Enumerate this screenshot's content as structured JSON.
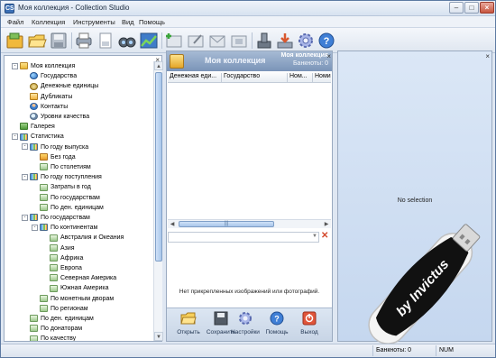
{
  "window": {
    "title": "Моя коллекция - Collection Studio",
    "app_icon": "CS"
  },
  "menu": {
    "items": [
      "Файл",
      "Коллекция",
      "Инструменты",
      "Вид",
      "Помощь"
    ]
  },
  "toolbar": {
    "icons": [
      "open-collection-icon",
      "open-folder-icon",
      "save-icon",
      "print-icon",
      "page-icon",
      "binoculars-icon",
      "chart-icon",
      "add-item-icon",
      "edit-item-icon",
      "mail-icon",
      "item-icon",
      "stamp-icon",
      "download-icon",
      "settings-icon",
      "help-icon"
    ]
  },
  "tree": {
    "nodes": [
      {
        "label": "Моя коллекция",
        "depth": 0,
        "toggle": "-",
        "icon": "folder"
      },
      {
        "label": "Государства",
        "depth": 1,
        "toggle": "",
        "icon": "globe"
      },
      {
        "label": "Денежные единицы",
        "depth": 1,
        "toggle": "",
        "icon": "coin"
      },
      {
        "label": "Дубликаты",
        "depth": 1,
        "toggle": "",
        "icon": "dup"
      },
      {
        "label": "Контакты",
        "depth": 1,
        "toggle": "",
        "icon": "person"
      },
      {
        "label": "Уровни качества",
        "depth": 1,
        "toggle": "",
        "icon": "mag"
      },
      {
        "label": "Галерея",
        "depth": 0,
        "toggle": "",
        "icon": "gallery"
      },
      {
        "label": "Статистика",
        "depth": 0,
        "toggle": "-",
        "icon": "chart"
      },
      {
        "label": "По году выпуска",
        "depth": 1,
        "toggle": "-",
        "icon": "chart"
      },
      {
        "label": "Без года",
        "depth": 2,
        "toggle": "",
        "icon": "flag"
      },
      {
        "label": "По столетиям",
        "depth": 2,
        "toggle": "",
        "icon": "sub"
      },
      {
        "label": "По году поступления",
        "depth": 1,
        "toggle": "-",
        "icon": "chart"
      },
      {
        "label": "Затраты в год",
        "depth": 2,
        "toggle": "",
        "icon": "sub"
      },
      {
        "label": "По государствам",
        "depth": 2,
        "toggle": "",
        "icon": "sub"
      },
      {
        "label": "По ден. единицам",
        "depth": 2,
        "toggle": "",
        "icon": "sub"
      },
      {
        "label": "По государствам",
        "depth": 1,
        "toggle": "-",
        "icon": "chart"
      },
      {
        "label": "По континентам",
        "depth": 2,
        "toggle": "-",
        "icon": "chart"
      },
      {
        "label": "Австралия и Океания",
        "depth": 3,
        "toggle": "",
        "icon": "sub"
      },
      {
        "label": "Азия",
        "depth": 3,
        "toggle": "",
        "icon": "sub"
      },
      {
        "label": "Африка",
        "depth": 3,
        "toggle": "",
        "icon": "sub"
      },
      {
        "label": "Европа",
        "depth": 3,
        "toggle": "",
        "icon": "sub"
      },
      {
        "label": "Северная Америка",
        "depth": 3,
        "toggle": "",
        "icon": "sub"
      },
      {
        "label": "Южная Америка",
        "depth": 3,
        "toggle": "",
        "icon": "sub"
      },
      {
        "label": "По монетным дворам",
        "depth": 2,
        "toggle": "",
        "icon": "sub"
      },
      {
        "label": "По регионам",
        "depth": 2,
        "toggle": "",
        "icon": "sub"
      },
      {
        "label": "По ден. единицам",
        "depth": 1,
        "toggle": "",
        "icon": "sub"
      },
      {
        "label": "По донаторам",
        "depth": 1,
        "toggle": "",
        "icon": "sub"
      },
      {
        "label": "По качеству",
        "depth": 1,
        "toggle": "",
        "icon": "sub"
      },
      {
        "label": "По материалу",
        "depth": 1,
        "toggle": "",
        "icon": "sub"
      }
    ]
  },
  "collection": {
    "title": "Моя коллекция",
    "owner_line": "Моя коллекция",
    "count_line": "Банкноты: 0",
    "columns": [
      "Денежная еди...",
      "Государство",
      "Ном...",
      "Номин"
    ],
    "scroll_grip": "|||",
    "no_images": "Нет прикрепленных изображений или фотографий.",
    "footer_buttons": [
      {
        "label": "Открыть",
        "icon": "open-folder-icon"
      },
      {
        "label": "Сохранить",
        "icon": "save-icon"
      },
      {
        "label": "Настройки",
        "icon": "settings-icon"
      },
      {
        "label": "Помощь",
        "icon": "help-icon"
      },
      {
        "label": "Выход",
        "icon": "exit-icon"
      }
    ]
  },
  "detail": {
    "empty_text": "No selection"
  },
  "status": {
    "count": "Банкноты: 0",
    "num": "NUM"
  },
  "watermark": {
    "text": "by Invictus"
  },
  "colors": {
    "accent": "#3b70b6",
    "header": "#7a94b8",
    "panel_bg": "#dfe7f2"
  }
}
